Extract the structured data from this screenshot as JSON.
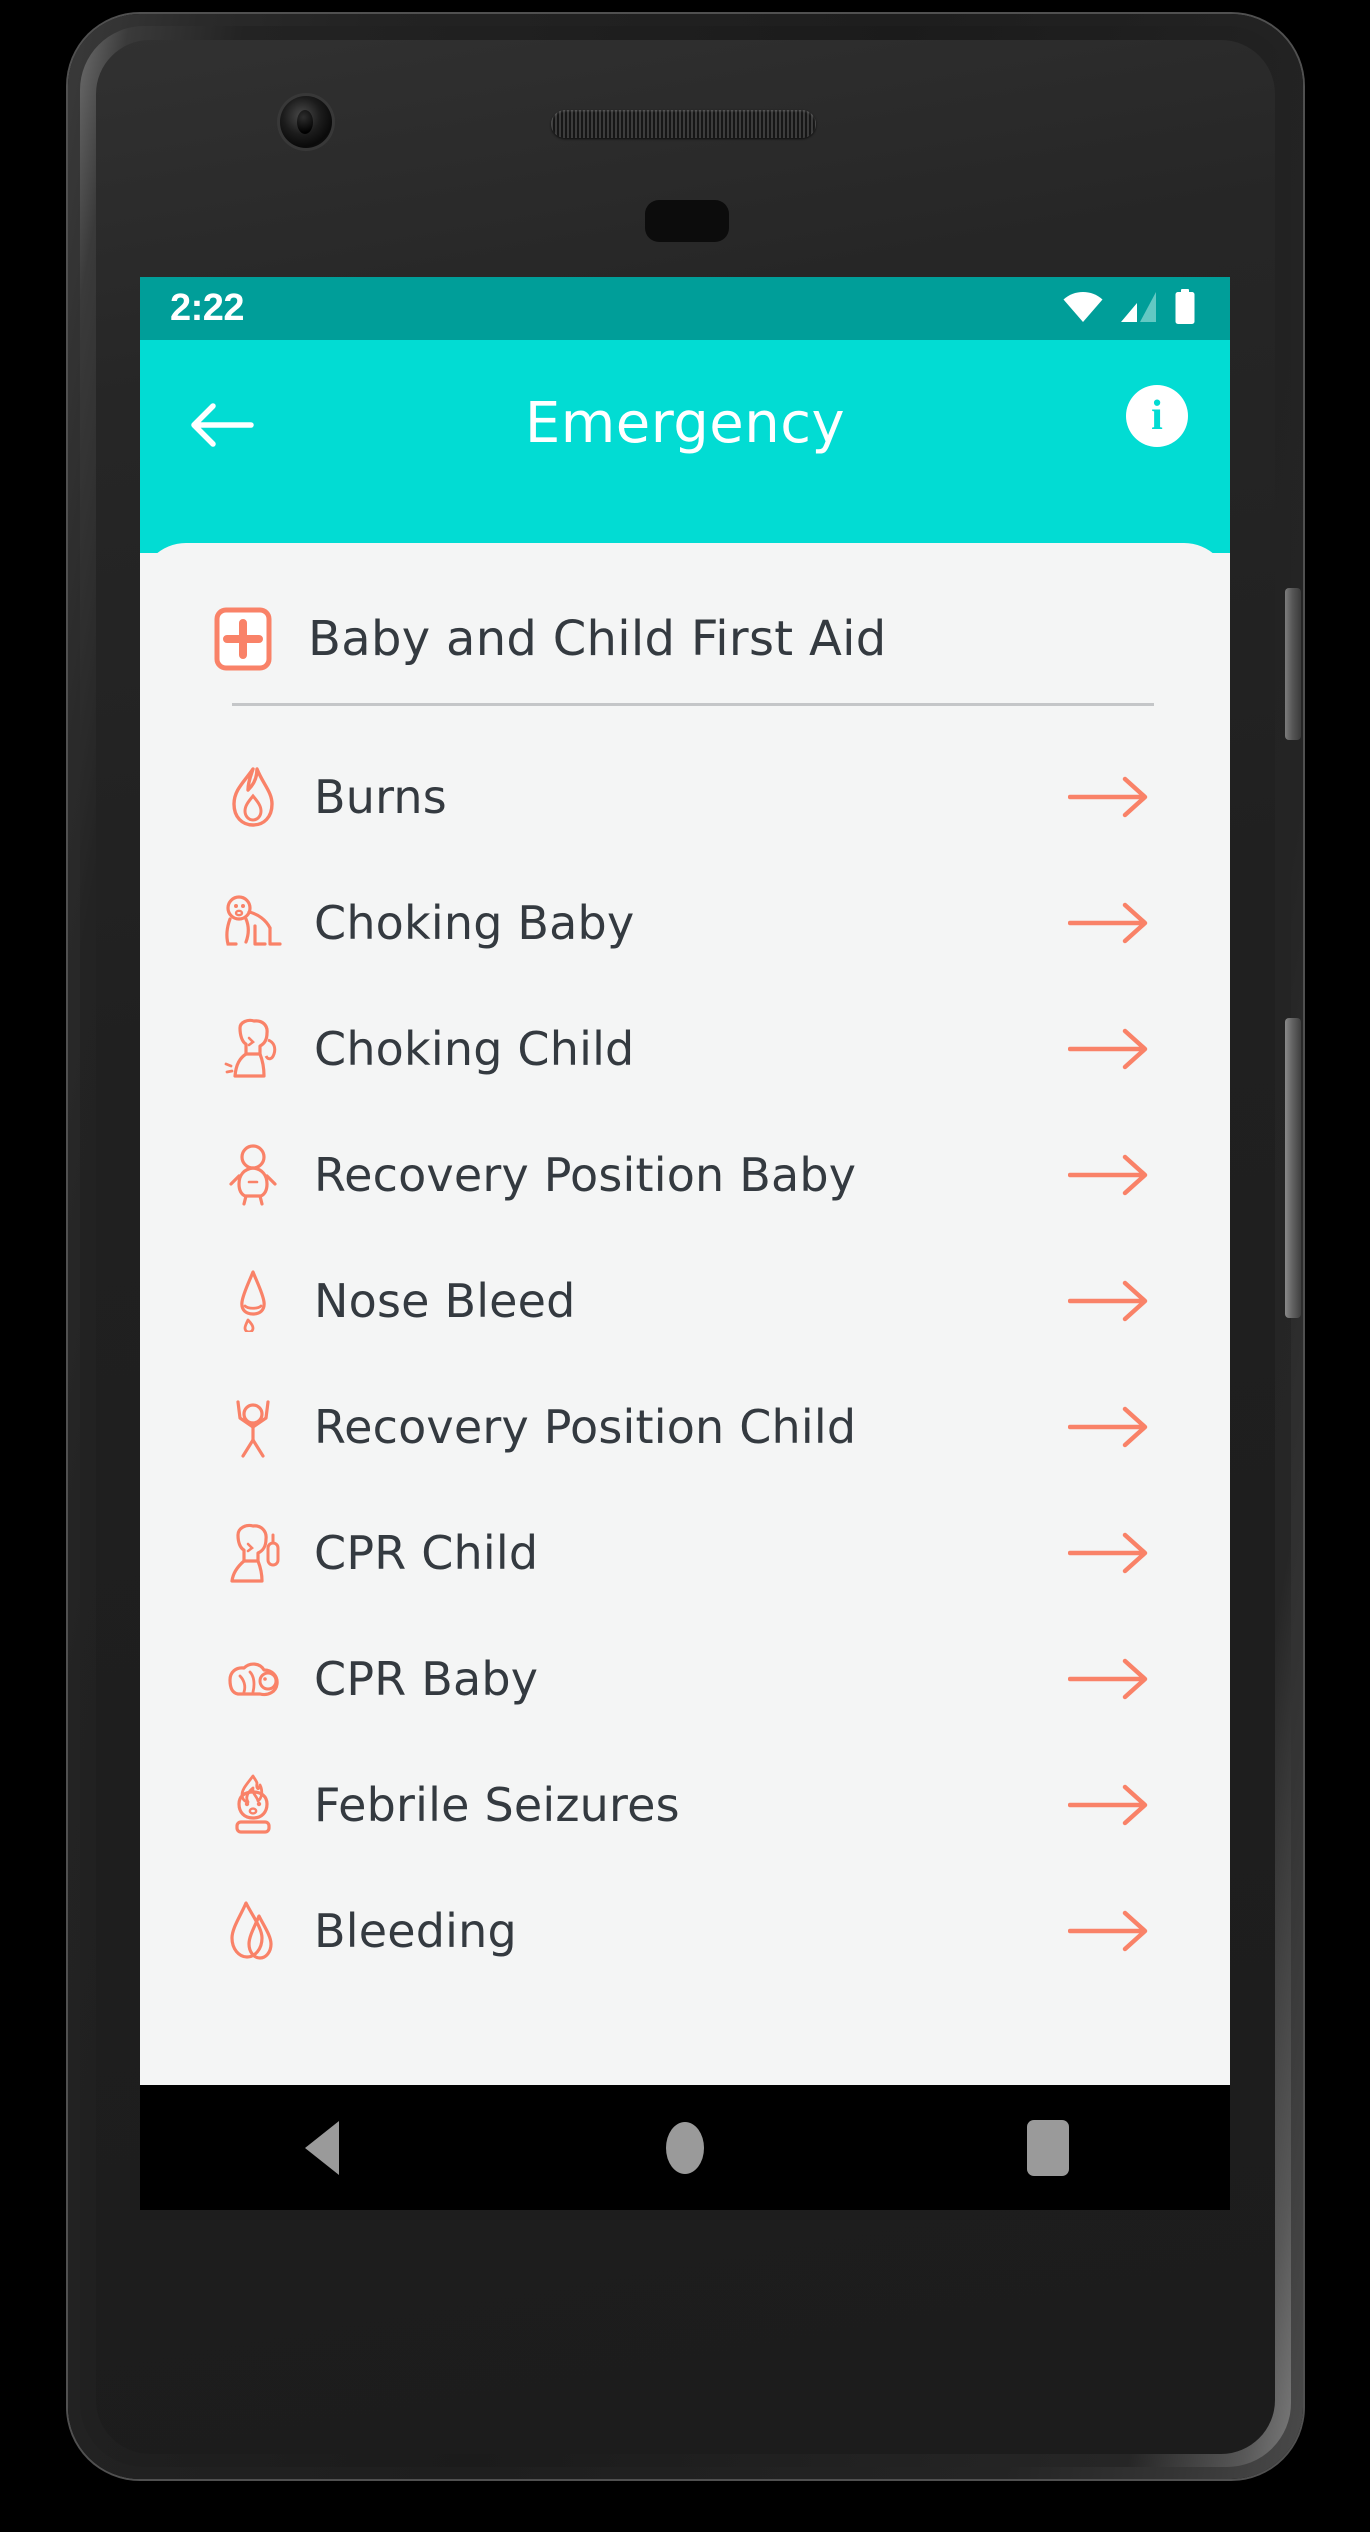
{
  "status_bar": {
    "time": "2:22",
    "icons": [
      "wifi-icon",
      "cellular-signal-icon",
      "battery-icon"
    ]
  },
  "app_bar": {
    "title": "Emergency",
    "back_icon": "back-arrow-icon",
    "info_icon": "info-icon",
    "info_glyph": "i"
  },
  "section": {
    "label": "Baby and Child First Aid",
    "icon": "first-aid-cross-icon"
  },
  "list": {
    "items": [
      {
        "label": "Burns",
        "icon": "flame-icon",
        "arrow": "right-arrow-icon"
      },
      {
        "label": "Choking Baby",
        "icon": "crawling-baby-icon",
        "arrow": "right-arrow-icon"
      },
      {
        "label": "Choking Child",
        "icon": "child-choking-icon",
        "arrow": "right-arrow-icon"
      },
      {
        "label": "Recovery Position Baby",
        "icon": "baby-lying-icon",
        "arrow": "right-arrow-icon"
      },
      {
        "label": "Nose Bleed",
        "icon": "nose-drip-icon",
        "arrow": "right-arrow-icon"
      },
      {
        "label": "Recovery Position Child",
        "icon": "child-figure-icon",
        "arrow": "right-arrow-icon"
      },
      {
        "label": "CPR Child",
        "icon": "child-cpr-icon",
        "arrow": "right-arrow-icon"
      },
      {
        "label": "CPR Baby",
        "icon": "baby-cpr-icon",
        "arrow": "right-arrow-icon"
      },
      {
        "label": "Febrile Seizures",
        "icon": "feverish-child-icon",
        "arrow": "right-arrow-icon"
      },
      {
        "label": "Bleeding",
        "icon": "blood-drop-icon",
        "arrow": "right-arrow-icon"
      }
    ]
  },
  "nav_bar": {
    "back": "nav-back-icon",
    "home": "nav-home-icon",
    "recents": "nav-recents-icon"
  },
  "colors": {
    "status_bar": "#009e99",
    "app_bar": "#02dcd3",
    "card_bg": "#f4f5f5",
    "accent": "#f98268",
    "text": "#343a40",
    "divider": "#c4c6c8",
    "nav_glyph": "#9a9a9a"
  }
}
